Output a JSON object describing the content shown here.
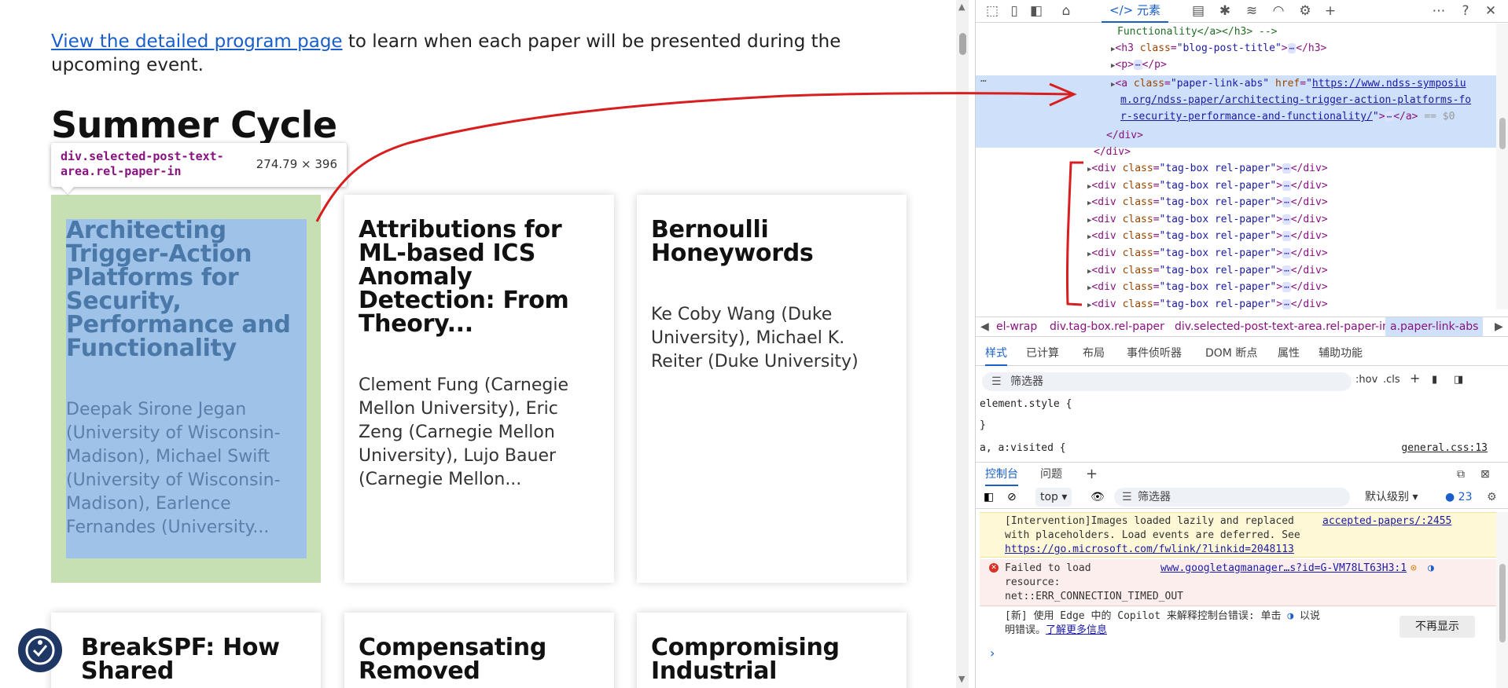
{
  "page": {
    "intro_link": "View the detailed program page",
    "intro_rest": " to learn when each paper will be presented during the upcoming event.",
    "cycle_title": "Summer Cycle",
    "tooltip": {
      "selector": "div.selected-post-text-area.rel-paper-in",
      "size": "274.79 × 396"
    },
    "cards": [
      {
        "title": "Architecting Trigger-Action Platforms for Security, Performance and Functionality",
        "authors": "Deepak Sirone Jegan (University of Wisconsin-Madison), Michael Swift (University of Wisconsin-Madison), Earlence Fernandes (University..."
      },
      {
        "title": "Attributions for ML-based ICS Anomaly Detection: From Theory...",
        "authors": "Clement Fung (Carnegie Mellon University), Eric Zeng (Carnegie Mellon University), Lujo Bauer (Carnegie Mellon..."
      },
      {
        "title": "Bernoulli Honeywords",
        "authors": "Ke Coby Wang (Duke University), Michael K. Reiter (Duke University)"
      },
      {
        "title": "BreakSPF: How Shared",
        "authors": ""
      },
      {
        "title": "Compensating Removed",
        "authors": ""
      },
      {
        "title": "Compromising Industrial",
        "authors": ""
      }
    ]
  },
  "devtools": {
    "elements_tab": "元素",
    "dom": {
      "line0": "Functionality</a></h3> -->",
      "h3_class": "blog-post-title",
      "a_class": "paper-link-abs",
      "a_href_1": "https://www.ndss-symposiu",
      "a_href_2": "m.org/ndss-paper/architecting-trigger-action-platforms-fo",
      "a_href_3": "r-security-performance-and-functionality/",
      "eq": "== $0",
      "close_div": "</div>",
      "tagbox_class": "tag-box rel-paper",
      "tagbox_count": 9
    },
    "breadcrumbs": [
      "el-wrap",
      "div.tag-box.rel-paper",
      "div.selected-post-text-area.rel-paper-in",
      "a.paper-link-abs"
    ],
    "subtabs": [
      "样式",
      "已计算",
      "布局",
      "事件侦听器",
      "DOM 断点",
      "属性",
      "辅助功能"
    ],
    "styles_filter": "筛选器",
    "hov": ":hov",
    "cls": ".cls",
    "rule1": "element.style {",
    "rule1_close": "}",
    "rule2": "a, a:visited {",
    "rule2_source": "general.css:13",
    "console_tabs": [
      "控制台",
      "问题"
    ],
    "context": "top",
    "console_filter": "筛选器",
    "level": "默认级别",
    "issues_count": "23",
    "warn_lines": [
      "[Intervention]Images loaded lazily and replaced",
      "with placeholders. Load events are deferred. See"
    ],
    "warn_link": "https://go.microsoft.com/fwlink/?linkid=2048113",
    "warn_source": "accepted-papers/:2455",
    "err_lines": [
      "Failed to load",
      "resource:",
      "net::ERR_CONNECTION_TIMED_OUT"
    ],
    "err_source": "www.googletagmanager…s?id=G-VM78LT63H3:1",
    "info_line1": "[新] 使用 Edge 中的 Copilot 来解释控制台错误: 单击",
    "info_line1b": "以说",
    "info_line2a": "明错误。",
    "info_link": "了解更多信息",
    "dismiss": "不再显示"
  }
}
